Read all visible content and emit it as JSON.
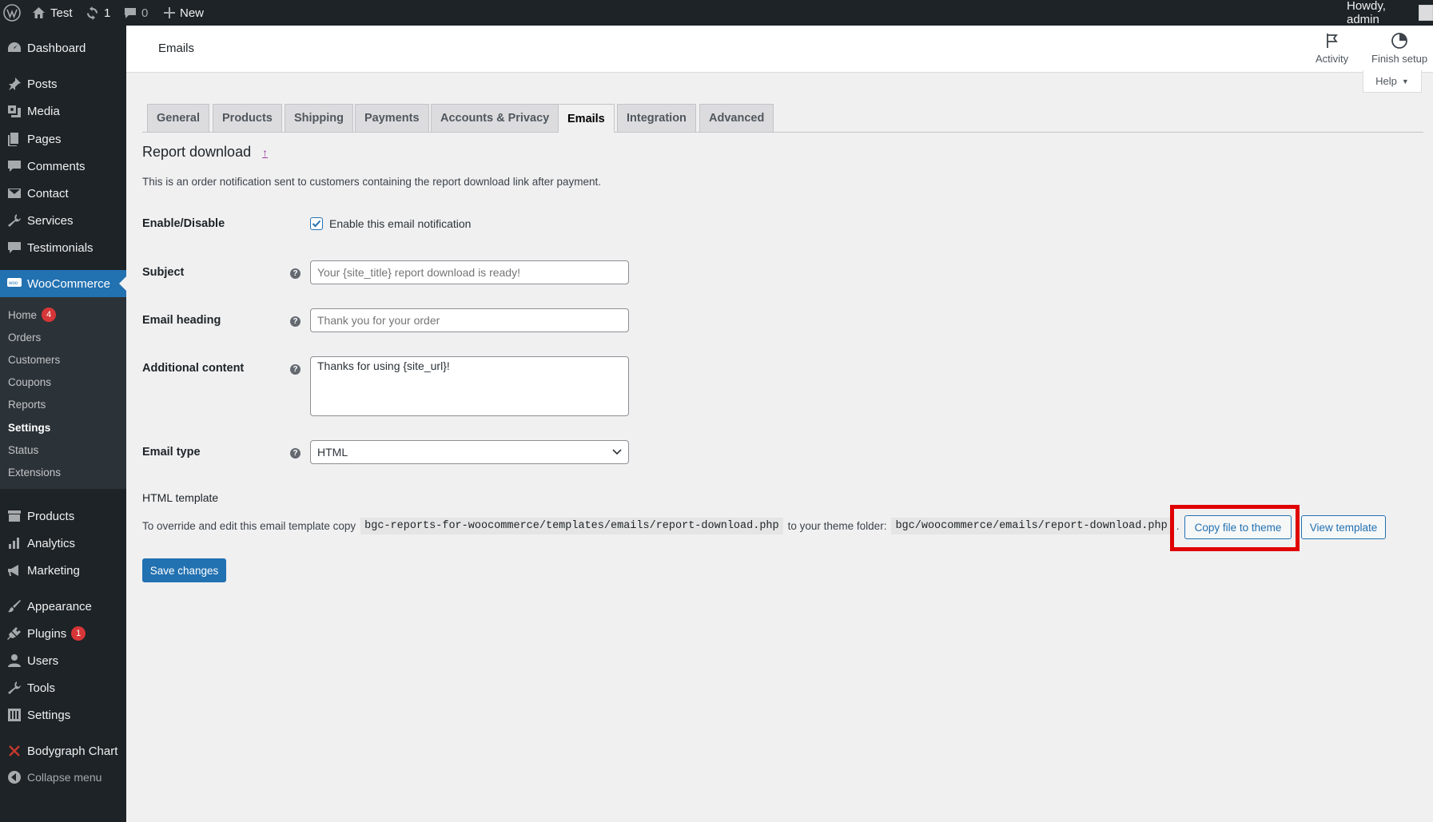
{
  "admin_bar": {
    "site_name": "Test",
    "updates_count": "1",
    "comments_count": "0",
    "new_label": "New",
    "howdy": "Howdy, admin"
  },
  "sidebar": {
    "items": [
      {
        "label": "Dashboard",
        "icon": "dashboard-icon"
      },
      {
        "label": "Posts",
        "icon": "pin-icon"
      },
      {
        "label": "Media",
        "icon": "media-icon"
      },
      {
        "label": "Pages",
        "icon": "pages-icon"
      },
      {
        "label": "Comments",
        "icon": "comment-icon"
      },
      {
        "label": "Contact",
        "icon": "mail-icon"
      },
      {
        "label": "Services",
        "icon": "wrench-icon"
      },
      {
        "label": "Testimonials",
        "icon": "comment-icon"
      },
      {
        "label": "WooCommerce",
        "icon": "woo-icon"
      },
      {
        "label": "Products",
        "icon": "archive-icon"
      },
      {
        "label": "Analytics",
        "icon": "bar-chart-icon"
      },
      {
        "label": "Marketing",
        "icon": "megaphone-icon"
      },
      {
        "label": "Appearance",
        "icon": "brush-icon"
      },
      {
        "label": "Plugins",
        "icon": "plug-icon",
        "badge": "1"
      },
      {
        "label": "Users",
        "icon": "user-icon"
      },
      {
        "label": "Tools",
        "icon": "wrench-icon"
      },
      {
        "label": "Settings",
        "icon": "settings-icon"
      },
      {
        "label": "Bodygraph Chart",
        "icon": "x-icon"
      },
      {
        "label": "Collapse menu",
        "icon": "collapse-icon"
      }
    ],
    "woo_submenu": [
      {
        "label": "Home",
        "badge": "4"
      },
      {
        "label": "Orders"
      },
      {
        "label": "Customers"
      },
      {
        "label": "Coupons"
      },
      {
        "label": "Reports"
      },
      {
        "label": "Settings"
      },
      {
        "label": "Status"
      },
      {
        "label": "Extensions"
      }
    ]
  },
  "header": {
    "title": "Emails",
    "activity_label": "Activity",
    "finish_setup_label": "Finish setup",
    "help_label": "Help"
  },
  "tabs": [
    "General",
    "Products",
    "Shipping",
    "Payments",
    "Accounts & Privacy",
    "Emails",
    "Integration",
    "Advanced"
  ],
  "active_tab": "Emails",
  "content": {
    "heading": "Report download",
    "description": "This is an order notification sent to customers containing the report download link after payment.",
    "enable_label": "Enable/Disable",
    "enable_checkbox_label": "Enable this email notification",
    "enable_checked": true,
    "subject_label": "Subject",
    "subject_placeholder": "Your {site_title} report download is ready!",
    "heading_label": "Email heading",
    "heading_placeholder": "Thank you for your order",
    "additional_label": "Additional content",
    "additional_value": "Thanks for using {site_url}!",
    "email_type_label": "Email type",
    "email_type_value": "HTML",
    "template_heading": "HTML template",
    "template_text_1": "To override and edit this email template copy",
    "template_path": "bgc-reports-for-woocommerce/templates/emails/report-download.php",
    "template_text_2": "to your theme folder:",
    "theme_path": "bgc/woocommerce/emails/report-download.php",
    "template_text_3": ".",
    "copy_button": "Copy file to theme",
    "view_button": "View template",
    "save_button": "Save changes"
  },
  "colors": {
    "admin_dark": "#1d2327",
    "accent": "#2271b1",
    "highlight": "#e00000",
    "badge": "#d63638"
  }
}
